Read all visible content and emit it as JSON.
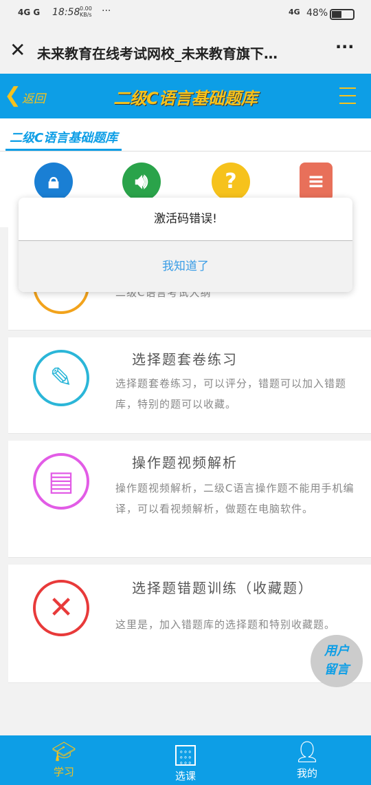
{
  "status": {
    "network": "4G G",
    "time": "18:58",
    "speed": "0.00 KB/s",
    "more": "···",
    "network_right": "4G",
    "battery": "48%"
  },
  "browser": {
    "title": "未来教育在线考试网校_未来教育旗下…",
    "more": "···"
  },
  "header": {
    "back": "返回",
    "title": "二级C语言基础题库"
  },
  "tab": {
    "label": "二级C语言基础题库"
  },
  "quick_icons": [
    {
      "icon": "lock-icon",
      "color": "#1a7fd4"
    },
    {
      "icon": "speaker-icon",
      "color": "#2aa34a"
    },
    {
      "icon": "question-icon",
      "color": "#f6c21c"
    },
    {
      "icon": "clipboard-icon",
      "color": "#e8705a"
    }
  ],
  "items": [
    {
      "icon": "book-icon",
      "color": "#f2a31c",
      "title": "",
      "desc": "二级C语言考试大纲"
    },
    {
      "icon": "pencil-icon",
      "color": "#2bb6d8",
      "title": "选择题套卷练习",
      "desc": "选择题套卷练习，可以评分，错题可以加入错题库，特别的题可以收藏。"
    },
    {
      "icon": "document-icon",
      "color": "#e25ce6",
      "title": "操作题视频解析",
      "desc": "操作题视频解析，二级C语言操作题不能用手机编译，可以看视频解析，做题在电脑软件。"
    },
    {
      "icon": "cross-icon",
      "color": "#e83a3a",
      "title": "选择题错题训练（收藏题）",
      "desc": "这里是，加入错题库的选择题和特别收藏题。"
    }
  ],
  "dialog": {
    "message": "激活码错误!",
    "button": "我知道了"
  },
  "float_button": "用户留言",
  "nav": [
    {
      "label": "学习",
      "active": true
    },
    {
      "label": "选课"
    },
    {
      "label": "我的"
    }
  ],
  "colors": {
    "primary": "#0d9ee6",
    "accent": "#f6c21c"
  }
}
